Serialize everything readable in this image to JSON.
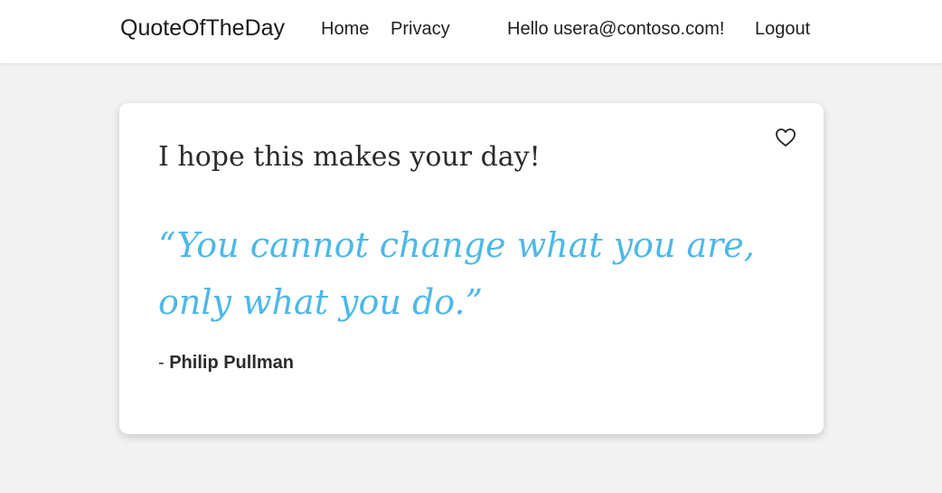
{
  "header": {
    "brand": "QuoteOfTheDay",
    "nav": {
      "home": "Home",
      "privacy": "Privacy"
    },
    "greeting": "Hello usera@contoso.com!",
    "logout": "Logout"
  },
  "card": {
    "heading": "I hope this makes your day!",
    "quote": "“You cannot change what you are, only what you do.”",
    "author_prefix": "- ",
    "author": "Philip Pullman",
    "favorite_icon": "heart-outline-icon"
  },
  "colors": {
    "background": "#f3f3f3",
    "quote": "#4db8e8",
    "text": "#2b2b2b"
  }
}
